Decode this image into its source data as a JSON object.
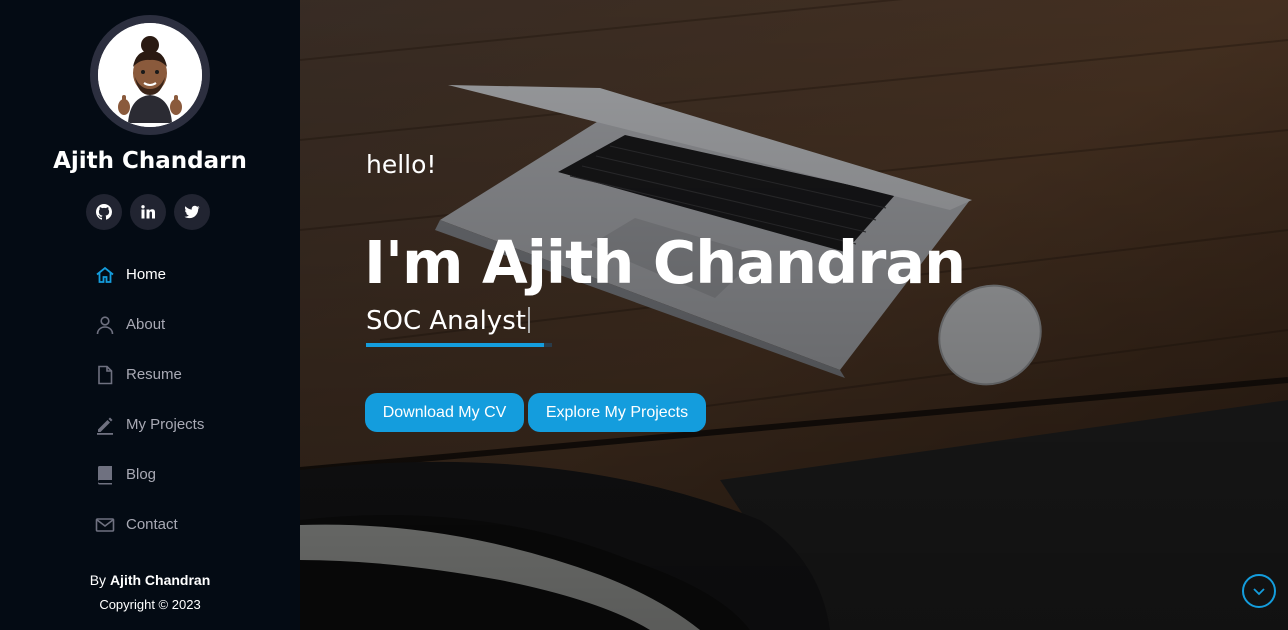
{
  "profile": {
    "name": "Ajith Chandarn"
  },
  "socials": [
    {
      "icon": "github-icon"
    },
    {
      "icon": "linkedin-icon"
    },
    {
      "icon": "twitter-icon"
    }
  ],
  "nav": {
    "items": [
      {
        "label": "Home",
        "icon": "home-icon",
        "active": true
      },
      {
        "label": "About",
        "icon": "user-icon"
      },
      {
        "label": "Resume",
        "icon": "file-icon"
      },
      {
        "label": "My Projects",
        "icon": "pencil-icon"
      },
      {
        "label": "Blog",
        "icon": "book-icon"
      },
      {
        "label": "Contact",
        "icon": "envelope-icon"
      }
    ]
  },
  "footer": {
    "by_prefix": "By",
    "by_name": "Ajith Chandran",
    "copyright": "Copyright © 2023"
  },
  "hero": {
    "greeting": "hello!",
    "headline": "I'm Ajith Chandran",
    "role": "SOC Analyst",
    "buttons": {
      "cv": "Download My CV",
      "projects": "Explore My Projects"
    }
  },
  "colors": {
    "accent": "#149ddd",
    "sidebar_bg": "#040b14",
    "nav_inactive": "#a8a9b4"
  }
}
